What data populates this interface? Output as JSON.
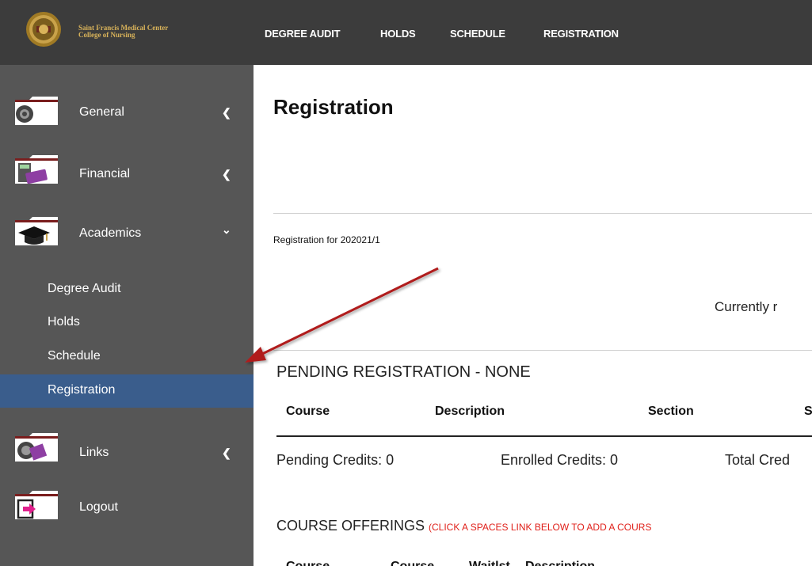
{
  "header": {
    "logo_text_line1": "Saint Francis Medical Center",
    "logo_text_line2": "College of Nursing",
    "nav": [
      "DEGREE AUDIT",
      "HOLDS",
      "SCHEDULE",
      "REGISTRATION"
    ]
  },
  "sidebar": {
    "general": "General",
    "financial": "Financial",
    "academics": "Academics",
    "sub_items": [
      "Degree Audit",
      "Holds",
      "Schedule",
      "Registration"
    ],
    "active_sub": "Registration",
    "links": "Links",
    "logout": "Logout",
    "chev_collapsed": "❮",
    "chev_expanded": "⌄"
  },
  "main": {
    "title": "Registration",
    "registration_for": "Registration for 202021/1",
    "currently": "Currently r",
    "pending_title": "PENDING REGISTRATION - NONE",
    "pending_columns": [
      "Course",
      "Description",
      "Section",
      "S"
    ],
    "pending_credits": "Pending Credits: 0",
    "enrolled_credits": "Enrolled Credits: 0",
    "total_credits": "Total Cred",
    "offerings_title": "COURSE OFFERINGS ",
    "offerings_note": "(CLICK A SPACES LINK BELOW TO ADD A COURS",
    "offerings_columns": [
      "Course",
      "Course",
      "Waitlst",
      "Description"
    ]
  },
  "colors": {
    "topbar": "#3c3c3c",
    "sidebar": "#565656",
    "active_item": "#3a5d8c",
    "note_red": "#e0201a",
    "arrow": "#b01e1e"
  }
}
